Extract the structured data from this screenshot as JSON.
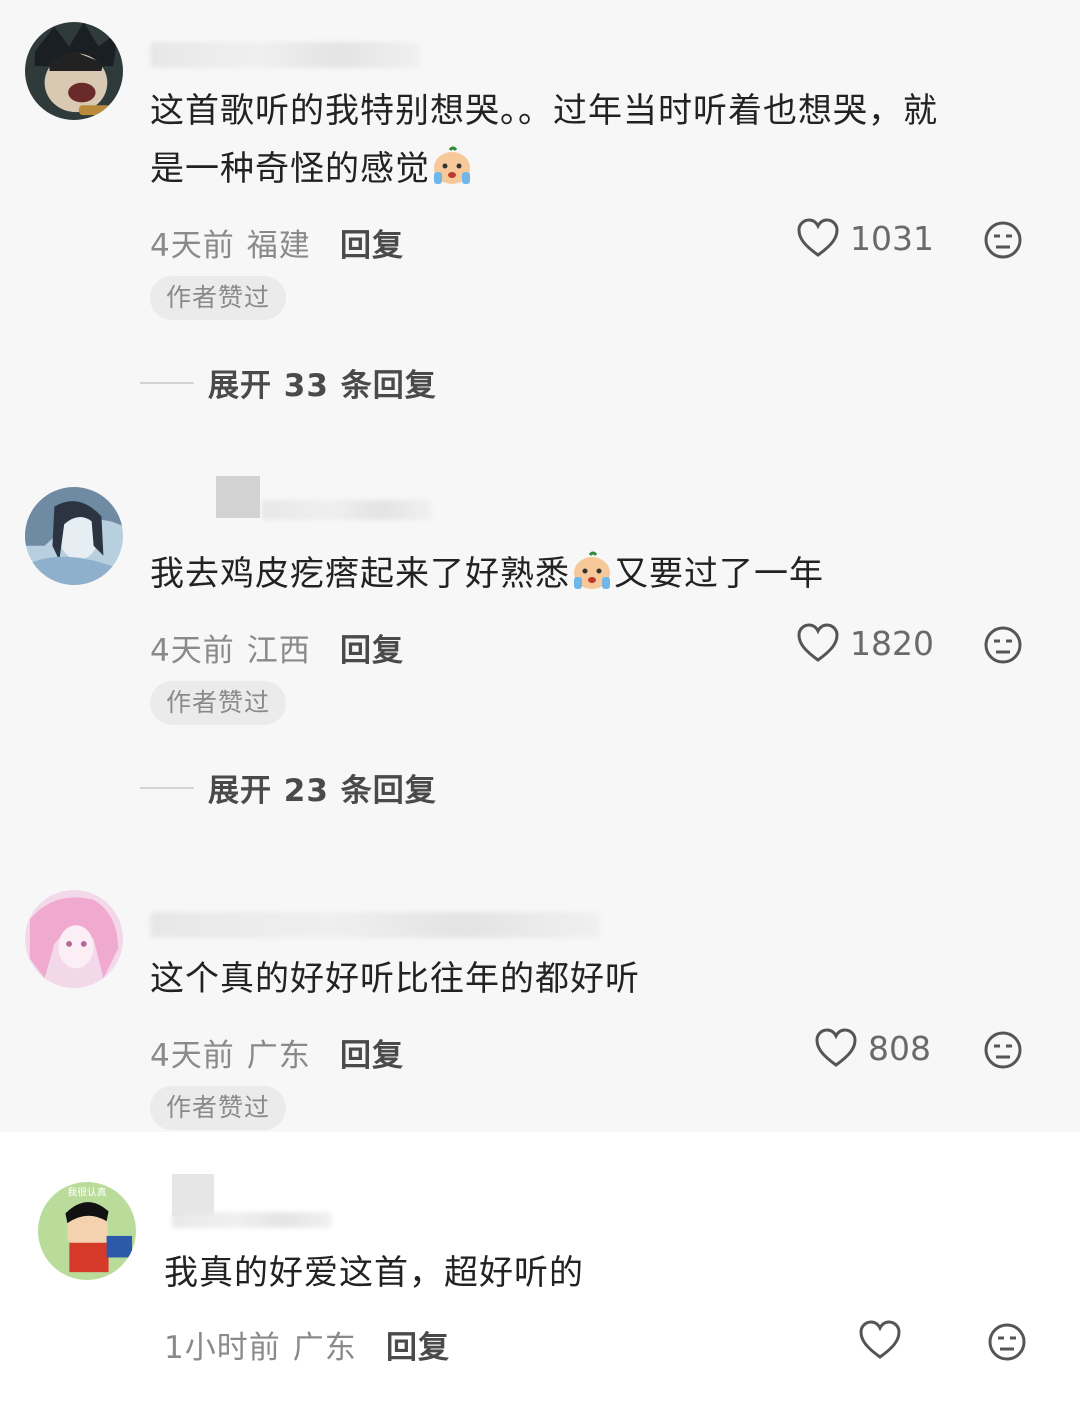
{
  "comments": [
    {
      "text_line1": "这首歌听的我特别想哭。。过年当时听着也想哭，就",
      "text_line2": "是一种奇怪的感觉",
      "time": "4天前",
      "location": "福建",
      "reply_label": "回复",
      "likes": "1031",
      "tag": "作者赞过",
      "expand_label": "展开 33 条回复"
    },
    {
      "text_before_emoji": "我去鸡皮疙瘩起来了好熟悉",
      "text_after_emoji": "又要过了一年",
      "time": "4天前",
      "location": "江西",
      "reply_label": "回复",
      "likes": "1820",
      "tag": "作者赞过",
      "expand_label": "展开 23 条回复"
    },
    {
      "text": "这个真的好好听比往年的都好听",
      "time": "4天前",
      "location": "广东",
      "reply_label": "回复",
      "likes": "808",
      "tag": "作者赞过"
    },
    {
      "text": "我真的好爱这首，超好听的",
      "time": "1小时前",
      "location": "广东",
      "reply_label": "回复",
      "avatar_text": "我很认真"
    }
  ],
  "icons": {
    "like": "heart-outline-icon",
    "dislike": "neutral-face-icon",
    "emoji": "crying-face-emoji"
  }
}
